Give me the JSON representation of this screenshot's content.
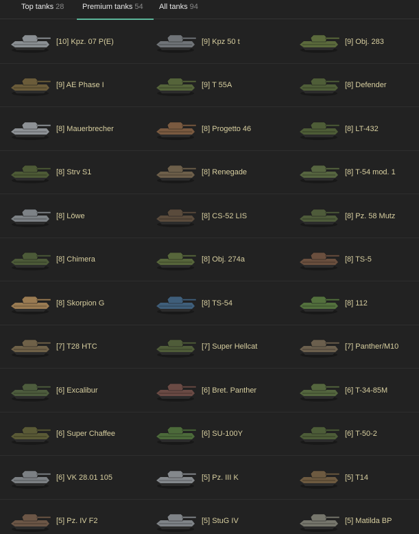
{
  "tabs": [
    {
      "label": "Top tanks",
      "count": "28",
      "active": false
    },
    {
      "label": "Premium tanks",
      "count": "54",
      "active": true
    },
    {
      "label": "All tanks",
      "count": "94",
      "active": false
    }
  ],
  "tanks": [
    {
      "name": "[10] Kpz. 07 P(E)",
      "icon": "tank-icon",
      "color": "#8a8f93"
    },
    {
      "name": "[9] Kpz 50 t",
      "icon": "tank-icon",
      "color": "#707478"
    },
    {
      "name": "[9] Obj. 283",
      "icon": "tank-icon",
      "color": "#5b6a3c"
    },
    {
      "name": "[9] AE Phase I",
      "icon": "tank-icon",
      "color": "#6b5c3a"
    },
    {
      "name": "[9] T 55A",
      "icon": "tank-icon",
      "color": "#55643a"
    },
    {
      "name": "[8] Defender",
      "icon": "tank-icon",
      "color": "#4f5e38"
    },
    {
      "name": "[8] Mauerbrecher",
      "icon": "tank-icon",
      "color": "#8e9296"
    },
    {
      "name": "[8] Progetto 46",
      "icon": "tank-icon",
      "color": "#7a5a40"
    },
    {
      "name": "[8] LT-432",
      "icon": "tank-icon",
      "color": "#4e5d37"
    },
    {
      "name": "[8] Strv S1",
      "icon": "tank-icon",
      "color": "#4d5a36"
    },
    {
      "name": "[8] Renegade",
      "icon": "tank-icon",
      "color": "#6d5f4a"
    },
    {
      "name": "[8] T-54 mod. 1",
      "icon": "tank-icon",
      "color": "#566540"
    },
    {
      "name": "[8] Löwe",
      "icon": "tank-icon",
      "color": "#7d8286"
    },
    {
      "name": "[8] CS-52 LIS",
      "icon": "tank-icon",
      "color": "#5a4b3c"
    },
    {
      "name": "[8] Pz. 58 Mutz",
      "icon": "tank-icon",
      "color": "#4e5b3a"
    },
    {
      "name": "[8] Chimera",
      "icon": "tank-icon",
      "color": "#4c5a38"
    },
    {
      "name": "[8] Obj. 274a",
      "icon": "tank-icon",
      "color": "#57663b"
    },
    {
      "name": "[8] TS-5",
      "icon": "tank-icon",
      "color": "#6a4f3e"
    },
    {
      "name": "[8] Skorpion G",
      "icon": "tank-icon",
      "color": "#9a7b52"
    },
    {
      "name": "[8] TS-54",
      "icon": "tank-icon",
      "color": "#3f5e7a"
    },
    {
      "name": "[8] 112",
      "icon": "tank-icon",
      "color": "#53703d"
    },
    {
      "name": "[7] T28 HTC",
      "icon": "tank-icon",
      "color": "#6f6148"
    },
    {
      "name": "[7] Super Hellcat",
      "icon": "tank-icon",
      "color": "#4f5c39"
    },
    {
      "name": "[7] Panther/M10",
      "icon": "tank-icon",
      "color": "#6b5f4d"
    },
    {
      "name": "[6] Excalibur",
      "icon": "tank-icon",
      "color": "#4d5c3d"
    },
    {
      "name": "[6] Bret. Panther",
      "icon": "tank-icon",
      "color": "#6a4a44"
    },
    {
      "name": "[6] T-34-85M",
      "icon": "tank-icon",
      "color": "#54663e"
    },
    {
      "name": "[6] Super Chaffee",
      "icon": "tank-icon",
      "color": "#5a5a36"
    },
    {
      "name": "[6] SU-100Y",
      "icon": "tank-icon",
      "color": "#4c6a3a"
    },
    {
      "name": "[6] T-50-2",
      "icon": "tank-icon",
      "color": "#4d5d38"
    },
    {
      "name": "[6] VK 28.01 105",
      "icon": "tank-icon",
      "color": "#7c8084"
    },
    {
      "name": "[5] Pz. III K",
      "icon": "tank-icon",
      "color": "#84888c"
    },
    {
      "name": "[5] T14",
      "icon": "tank-icon",
      "color": "#6d5a40"
    },
    {
      "name": "[5] Pz. IV F2",
      "icon": "tank-icon",
      "color": "#6c5646"
    },
    {
      "name": "[5] StuG IV",
      "icon": "tank-icon",
      "color": "#7f8387"
    },
    {
      "name": "[5] Matilda BP",
      "icon": "tank-icon",
      "color": "#76766c"
    }
  ]
}
